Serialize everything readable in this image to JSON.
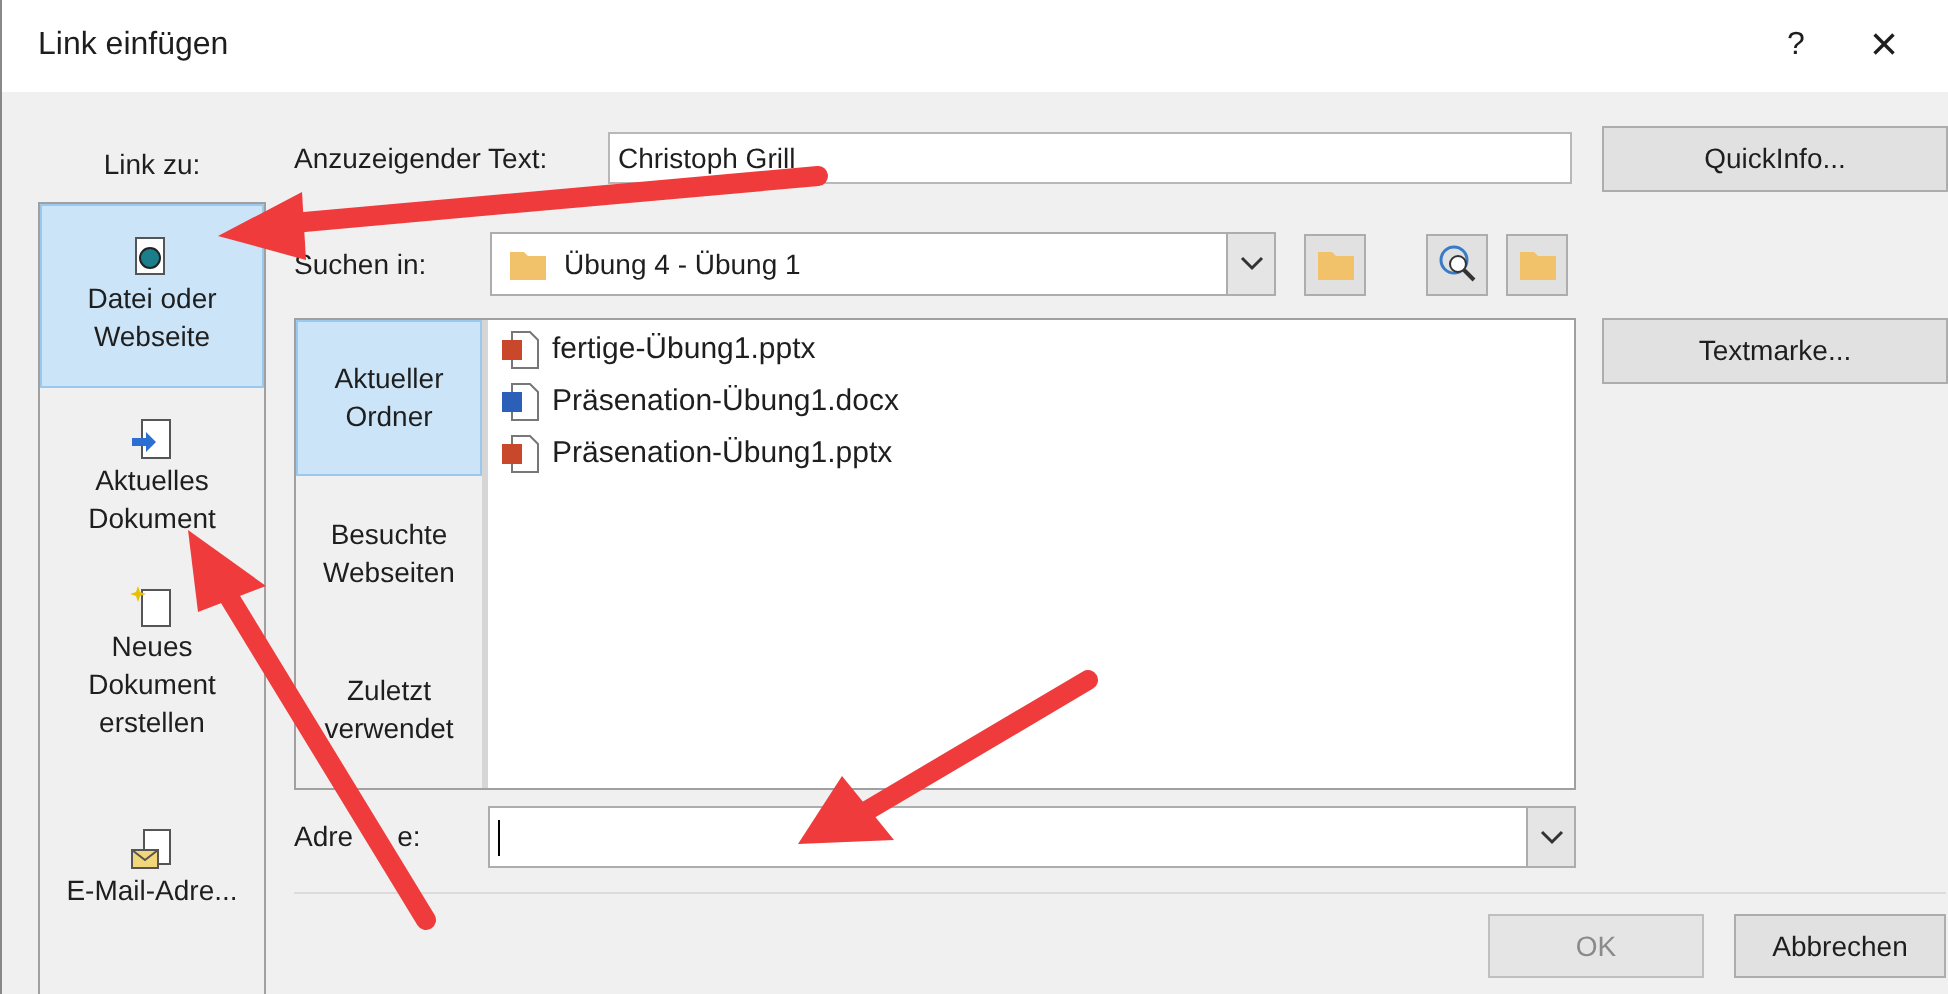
{
  "window": {
    "title": "Link einfügen",
    "help": "?",
    "close": "×"
  },
  "link_to": {
    "label": "Link zu:",
    "items": [
      {
        "label": "Datei oder Webseite",
        "kind": "file",
        "selected": true
      },
      {
        "label": "Aktuelles Dokument",
        "kind": "document",
        "selected": false
      },
      {
        "label": "Neues Dokument erstellen",
        "kind": "new",
        "selected": false
      },
      {
        "label": "E-Mail-Adre...",
        "kind": "mail",
        "selected": false
      }
    ]
  },
  "display_text": {
    "label": "Anzuzeigender Text:",
    "value": "Christoph Grill"
  },
  "look_in": {
    "label": "Suchen in:",
    "value": "Übung 4 - Übung 1"
  },
  "nav": [
    {
      "label": "Aktueller Ordner",
      "selected": true
    },
    {
      "label": "Besuchte Webseiten",
      "selected": false
    },
    {
      "label": "Zuletzt verwendet",
      "selected": false
    }
  ],
  "files": [
    {
      "name": "fertige-Übung1.pptx",
      "kind": "pptx"
    },
    {
      "name": "Präsenation-Übung1.docx",
      "kind": "docx"
    },
    {
      "name": "Präsenation-Übung1.pptx",
      "kind": "pptx"
    }
  ],
  "address": {
    "label_visible_parts": [
      "Adre",
      "e:"
    ]
  },
  "buttons": {
    "quickinfo": "QuickInfo...",
    "bookmark": "Textmarke...",
    "ok": {
      "label": "OK",
      "disabled": true
    },
    "cancel": {
      "label": "Abbrechen",
      "disabled": false
    }
  }
}
